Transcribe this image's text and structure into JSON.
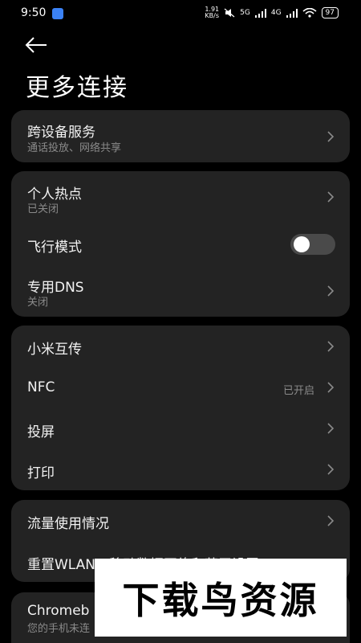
{
  "status_bar": {
    "time": "9:50",
    "net_speed_value": "1.91",
    "net_speed_unit": "KB/s",
    "signal_5g": "5G",
    "signal_4g": "4G",
    "battery": "97"
  },
  "header": {
    "title": "更多连接",
    "back_icon": "back-arrow-icon"
  },
  "cards": [
    {
      "items": [
        {
          "label": "跨设备服务",
          "subtitle": "通话投放、网络共享"
        }
      ]
    },
    {
      "items": [
        {
          "label": "个人热点",
          "subtitle": "已关闭"
        },
        {
          "label": "飞行模式",
          "toggle": false
        },
        {
          "label": "专用DNS",
          "subtitle": "关闭"
        }
      ]
    },
    {
      "items": [
        {
          "label": "小米互传"
        },
        {
          "label": "NFC",
          "value": "已开启"
        },
        {
          "label": "投屏"
        },
        {
          "label": "打印"
        }
      ]
    },
    {
      "items": [
        {
          "label": "流量使用情况"
        },
        {
          "label": "重置WLAN、移动数据网络和蓝牙设置"
        }
      ]
    },
    {
      "items": [
        {
          "label": "Chromeb",
          "subtitle": "您的手机未连"
        }
      ]
    }
  ],
  "watermark": "下载鸟资源",
  "colors": {
    "background": "#000000",
    "card": "#232323",
    "secondary_text": "#8a8a8a"
  }
}
